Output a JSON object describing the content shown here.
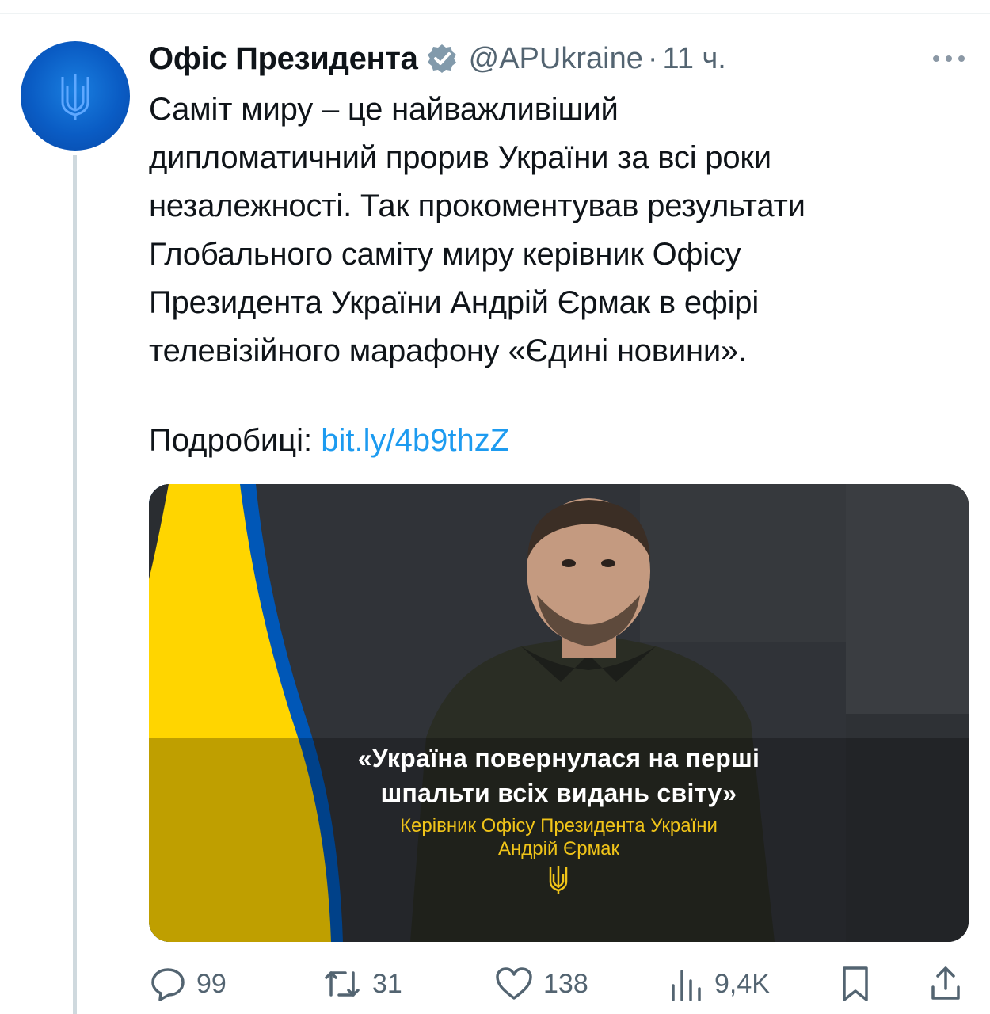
{
  "account": {
    "display_name": "Офіс Президента",
    "handle": "@APUkraine",
    "separator": "·",
    "time": "11 ч.",
    "avatar_icon": "trident-icon",
    "verified_icon": "verified-badge-icon"
  },
  "tweet": {
    "text_lines": [
      "Саміт миру – це найважливіший",
      "дипломатичний прорив України за всі роки",
      "незалежності. Так прокоментував результати",
      "Глобального саміту миру керівник Офісу",
      "Президента України Андрій Єрмак в ефірі",
      "телевізійного марафону «Єдині новини»."
    ],
    "details_label": "Подробиці:",
    "link_text": "bit.ly/4b9thzZ"
  },
  "media": {
    "quote_line1": "«Україна повернулася на перші",
    "quote_line2": "шпальти всіх видань світу»",
    "attribution_line1": "Керівник Офісу Президента України",
    "attribution_line2": "Андрій Єрмак",
    "flag_colors": [
      "#0057b7",
      "#ffd500"
    ]
  },
  "actions": {
    "replies": "99",
    "reposts": "31",
    "likes": "138",
    "views": "9,4K"
  },
  "colors": {
    "text": "#0f1419",
    "secondary": "#536471",
    "link": "#1d9bf0",
    "gold": "#f0c419"
  }
}
